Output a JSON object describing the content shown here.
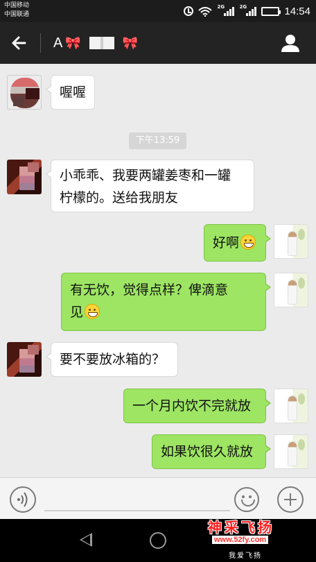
{
  "status_bar": {
    "carriers": [
      "中国移动",
      "中国联通"
    ],
    "network": [
      "2G",
      "2G"
    ],
    "time": "14:54"
  },
  "header": {
    "title_prefix": "A",
    "bow_emoji": "🎀",
    "back_icon": "arrow-left-icon",
    "profile_icon": "person-icon"
  },
  "chat": {
    "timestamp": "下午13:59",
    "messages": [
      {
        "side": "in",
        "text": "喔喔"
      },
      {
        "side": "in",
        "lines": [
          "小乖乖、我要两罐姜枣和一罐",
          "柠檬的。送给我朋友"
        ]
      },
      {
        "side": "out",
        "text": "好啊",
        "emoji": "grinning-emoji"
      },
      {
        "side": "out",
        "lines": [
          "有无饮，觉得点样？俾滴意",
          "见"
        ],
        "emoji": "grinning-emoji"
      },
      {
        "side": "in",
        "text": "要不要放冰箱的？"
      },
      {
        "side": "out",
        "text": "一个月内饮不完就放"
      },
      {
        "side": "out",
        "text": "如果饮很久就放"
      }
    ]
  },
  "input_bar": {
    "voice_icon": "voice-icon",
    "emoji_icon": "smiley-icon",
    "plus_icon": "plus-icon"
  },
  "watermark": {
    "title": "神采飞扬",
    "url": "www.52fy.com",
    "subtitle": "我爱飞扬"
  },
  "colors": {
    "outgoing_bubble": "#9de563",
    "incoming_bubble": "#ffffff",
    "header_bg": "#232323",
    "chat_bg": "#ebebeb"
  }
}
